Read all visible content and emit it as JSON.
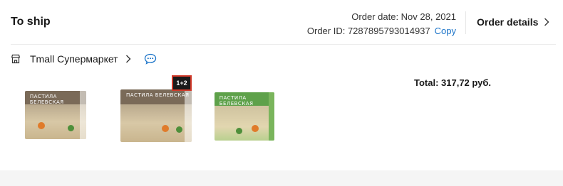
{
  "order": {
    "status": "To ship",
    "date_label": "Order date: Nov 28, 2021",
    "id_label": "Order ID: 7287895793014937",
    "copy_label": "Copy",
    "details_label": "Order details"
  },
  "store": {
    "name": "Tmall Супермаркет"
  },
  "total_label": "Total: 317,72 руб.",
  "products": [
    {
      "name": "product-1",
      "label": "ПАСТИЛА БЕЛЕВСКАЯ"
    },
    {
      "name": "product-2",
      "label": "ПАСТИЛА БЕЛЕВСКАЯ",
      "badge": "1+2"
    },
    {
      "name": "product-3",
      "label": "ПАСТИЛА БЕЛЕВСКАЯ"
    }
  ],
  "colors": {
    "link": "#1a73c8",
    "text": "#191919",
    "divider": "#ececec"
  },
  "icons": {
    "store": "store-icon",
    "store_chevron": "chevron-right-icon",
    "chat": "chat-icon",
    "details_chevron": "chevron-right-icon"
  }
}
